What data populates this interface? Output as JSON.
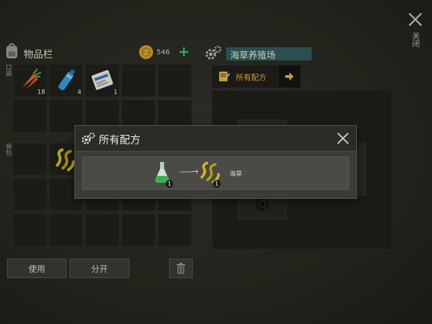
{
  "close_side_label": "关闭",
  "inventory": {
    "title": "物品栏",
    "coin_count": "546",
    "plus_symbol": "+",
    "section_pocket_label": "口袋",
    "section_bag_label": "背包",
    "items": [
      {
        "name": "carrot",
        "count": "18"
      },
      {
        "name": "water-bottle",
        "count": "4"
      },
      {
        "name": "seed-bag",
        "count": "1"
      }
    ],
    "use_button": "使用",
    "split_button": "分开"
  },
  "farm": {
    "title": "海草养殖场",
    "recipes_tab": "所有配方"
  },
  "modal": {
    "title": "所有配方",
    "recipe": {
      "input_count": "1",
      "arrow": "——→",
      "output_count": "1",
      "output_name": "海草"
    }
  },
  "colors": {
    "accent_gold": "#e8b23a",
    "teal_header": "#2f5b5a",
    "plus_green": "#3fbf6a"
  }
}
